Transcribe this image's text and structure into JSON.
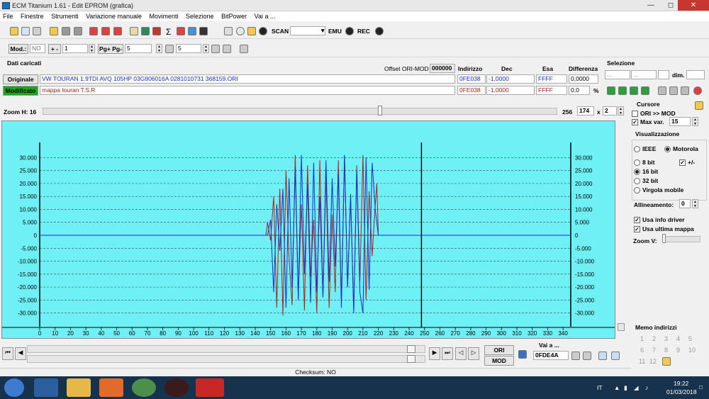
{
  "window": {
    "title": "ECM Titanium 1.61 - Edit EPROM (grafica)"
  },
  "menu": [
    "File",
    "Finestre",
    "Strumenti",
    "Variazione manuale",
    "Movimenti",
    "Selezione",
    "BitPower",
    "Vai a ..."
  ],
  "toolbar2": {
    "scan": "SCAN",
    "emu": "EMU",
    "rec": "REC"
  },
  "toolbar3": {
    "mod_label": "Mod.:",
    "mod_value": "NO",
    "plusminus": "+ -",
    "step": "1",
    "pg_label": "Pg+ Pg-",
    "pg_value": "5",
    "p_value": "5"
  },
  "data_panel": {
    "title": "Dati caricati",
    "offset_label": "Offset ORI-MOD",
    "offset_value": "000000",
    "headers": {
      "indirizzo": "Indirizzo",
      "dec": "Dec",
      "esa": "Esa",
      "differenza": "Differenza"
    },
    "originale": {
      "label": "Originale",
      "file": "VW TOURAN 1.9TDI AVQ 105HP 03G906016A 0281010731 368159.ORI",
      "addr": "0FE038",
      "dec": "-1,0000",
      "esa": "FFFF",
      "diff": "0,0000"
    },
    "modificato": {
      "label": "Modificato",
      "file": "mappa touran T.S.R",
      "addr": "0FE038",
      "dec": "-1,0000",
      "esa": "FFFF",
      "diff": "0,0",
      "pct": "%"
    }
  },
  "selezione": {
    "title": "Selezione",
    "f1": "...",
    "f2": "...",
    "dim_label": "dim."
  },
  "zoom": {
    "label": "Zoom H: 16",
    "max": "256",
    "value": "174",
    "x": "x",
    "mult": "2"
  },
  "cursore": {
    "title": "Cursore",
    "ori_mod": "ORI >> MOD",
    "maxvar_label": "Max var.",
    "maxvar_value": "15"
  },
  "visualizzazione": {
    "title": "Visualizzazione",
    "ieee": "IEEE",
    "motorola": "Motorola",
    "bits": [
      "8 bit",
      "16 bit",
      "32 bit",
      "Virgola mobile"
    ],
    "plusminus": "+/-",
    "allineamento_label": "Allineamento:",
    "allineamento_value": "0",
    "usa_info": "Usa info driver",
    "usa_ultima": "Usa ultima mappa",
    "zoom_v": "Zoom V:"
  },
  "nav": {
    "ori": "ORI",
    "mod": "MOD",
    "vai_label": "Vai a ...",
    "vai_value": "0FDE4A"
  },
  "memo": {
    "title": "Memo indirizzi",
    "numbers": [
      "1",
      "2",
      "3",
      "4",
      "5",
      "6",
      "7",
      "8",
      "9",
      "10",
      "11",
      "12"
    ]
  },
  "status": {
    "checksum": "Checksum: NO"
  },
  "taskbar": {
    "lang": "IT",
    "time": "19:22",
    "date": "01/03/2018"
  },
  "colors": {
    "chart_bg": "#6ef0f4",
    "ori_line": "#1a2fd6",
    "mod_line": "#b0201b",
    "modificato_bg": "#1aa81a"
  },
  "chart_data": {
    "type": "line",
    "title": "",
    "xlim": [
      0,
      345
    ],
    "ylim": [
      -32000,
      32000
    ],
    "x_ticks": [
      0,
      10,
      20,
      30,
      40,
      50,
      60,
      70,
      80,
      90,
      100,
      110,
      120,
      130,
      140,
      150,
      160,
      170,
      180,
      190,
      200,
      210,
      220,
      230,
      240,
      250,
      260,
      270,
      280,
      290,
      300,
      310,
      320,
      330,
      340
    ],
    "y_ticks": [
      30000,
      25000,
      20000,
      15000,
      10000,
      5000,
      0,
      -5000,
      -10000,
      -15000,
      -20000,
      -25000,
      -30000
    ],
    "y_tick_labels": [
      "30.000",
      "25.000",
      "20.000",
      "15.000",
      "10.000",
      "5.000",
      "0",
      "-5.000",
      "-10.000",
      "-15.000",
      "-20.000",
      "-25.000",
      "-30.000"
    ],
    "cursor_x": 248,
    "grid": true,
    "series": [
      {
        "x": [
          0,
          147,
          148,
          150,
          152,
          154,
          156,
          158,
          160,
          162,
          164,
          166,
          168,
          170,
          172,
          174,
          176,
          178,
          180,
          182,
          184,
          186,
          188,
          190,
          192,
          194,
          196,
          198,
          200,
          202,
          204,
          206,
          208,
          210,
          212,
          214,
          216,
          218,
          219,
          220,
          345
        ],
        "values": [
          0,
          0,
          5000,
          -2000,
          15000,
          -28000,
          18000,
          -31000,
          25000,
          -9000,
          -27000,
          31000,
          -24000,
          12000,
          -29000,
          27000,
          -16000,
          6000,
          -30000,
          29000,
          -24000,
          23000,
          -28000,
          8000,
          -22000,
          29000,
          -26000,
          31000,
          -20000,
          14000,
          -29000,
          27000,
          -18000,
          31000,
          -25000,
          17000,
          -8000,
          12000,
          20000,
          0,
          0
        ]
      },
      {
        "x": [
          0,
          148,
          150,
          152,
          154,
          156,
          158,
          160,
          162,
          164,
          166,
          168,
          170,
          172,
          174,
          176,
          178,
          180,
          182,
          184,
          186,
          188,
          190,
          192,
          194,
          196,
          198,
          200,
          202,
          204,
          206,
          208,
          210,
          212,
          214,
          216,
          218,
          220,
          345
        ],
        "values": [
          0,
          0,
          6000,
          -22000,
          12000,
          -6000,
          18000,
          -28000,
          22000,
          -20000,
          26000,
          -25000,
          31000,
          -15000,
          20000,
          -26000,
          28000,
          -22000,
          15000,
          -24000,
          29000,
          -18000,
          22000,
          -12000,
          24000,
          -28000,
          31000,
          -20000,
          16000,
          -30000,
          25000,
          -22000,
          -30000,
          30000,
          -21000,
          28000,
          10000,
          0,
          0
        ]
      }
    ]
  }
}
